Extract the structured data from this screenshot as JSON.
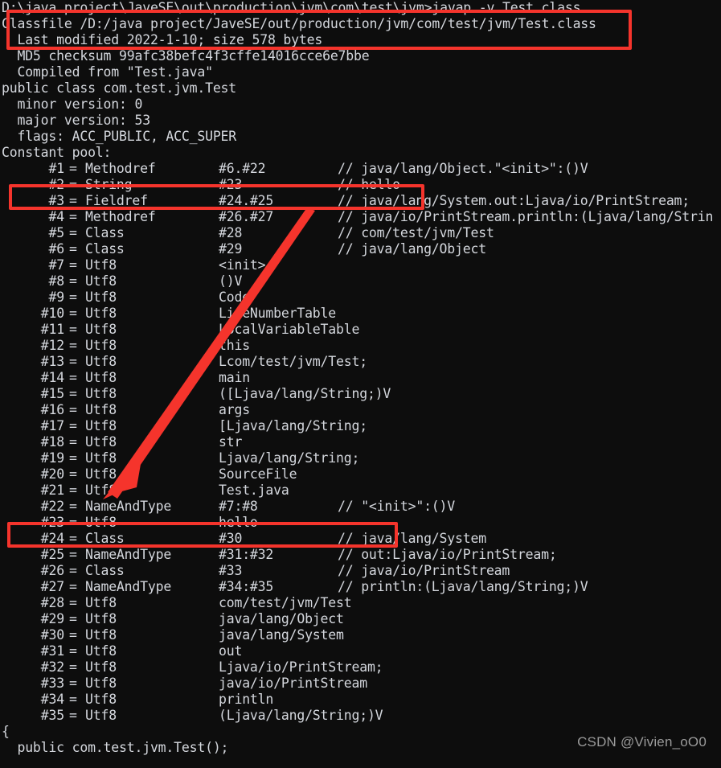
{
  "terminal": {
    "background": "#0d0d0d",
    "text_color": "#d4d7dd",
    "highlight_color": "#f5342c",
    "prompt_line": "D:\\java project\\JaveSE\\out\\production\\jvm\\com\\test\\jvm>javap -v Test.class",
    "header_lines": [
      "Classfile /D:/java project/JaveSE/out/production/jvm/com/test/jvm/Test.class",
      "  Last modified 2022-1-10; size 578 bytes",
      "  MD5 checksum 99afc38befc4f3cffe14016cce6e7bbe",
      "  Compiled from \"Test.java\"",
      "public class com.test.jvm.Test",
      "  minor version: 0",
      "  major version: 53",
      "  flags: ACC_PUBLIC, ACC_SUPER",
      "Constant pool:"
    ],
    "constant_pool": [
      {
        "index": "#1",
        "kind": "Methodref",
        "ref": "#6.#22",
        "comment": "// java/lang/Object.\"<init>\":()V"
      },
      {
        "index": "#2",
        "kind": "String",
        "ref": "#23",
        "comment": "// hello"
      },
      {
        "index": "#3",
        "kind": "Fieldref",
        "ref": "#24.#25",
        "comment": "// java/lang/System.out:Ljava/io/PrintStream;"
      },
      {
        "index": "#4",
        "kind": "Methodref",
        "ref": "#26.#27",
        "comment": "// java/io/PrintStream.println:(Ljava/lang/Strin"
      },
      {
        "index": "#5",
        "kind": "Class",
        "ref": "#28",
        "comment": "// com/test/jvm/Test"
      },
      {
        "index": "#6",
        "kind": "Class",
        "ref": "#29",
        "comment": "// java/lang/Object"
      },
      {
        "index": "#7",
        "kind": "Utf8",
        "ref": "<init>",
        "comment": ""
      },
      {
        "index": "#8",
        "kind": "Utf8",
        "ref": "()V",
        "comment": ""
      },
      {
        "index": "#9",
        "kind": "Utf8",
        "ref": "Code",
        "comment": ""
      },
      {
        "index": "#10",
        "kind": "Utf8",
        "ref": "LineNumberTable",
        "comment": ""
      },
      {
        "index": "#11",
        "kind": "Utf8",
        "ref": "LocalVariableTable",
        "comment": ""
      },
      {
        "index": "#12",
        "kind": "Utf8",
        "ref": "this",
        "comment": ""
      },
      {
        "index": "#13",
        "kind": "Utf8",
        "ref": "Lcom/test/jvm/Test;",
        "comment": ""
      },
      {
        "index": "#14",
        "kind": "Utf8",
        "ref": "main",
        "comment": ""
      },
      {
        "index": "#15",
        "kind": "Utf8",
        "ref": "([Ljava/lang/String;)V",
        "comment": ""
      },
      {
        "index": "#16",
        "kind": "Utf8",
        "ref": "args",
        "comment": ""
      },
      {
        "index": "#17",
        "kind": "Utf8",
        "ref": "[Ljava/lang/String;",
        "comment": ""
      },
      {
        "index": "#18",
        "kind": "Utf8",
        "ref": "str",
        "comment": ""
      },
      {
        "index": "#19",
        "kind": "Utf8",
        "ref": "Ljava/lang/String;",
        "comment": ""
      },
      {
        "index": "#20",
        "kind": "Utf8",
        "ref": "SourceFile",
        "comment": ""
      },
      {
        "index": "#21",
        "kind": "Utf8",
        "ref": "Test.java",
        "comment": ""
      },
      {
        "index": "#22",
        "kind": "NameAndType",
        "ref": "#7:#8",
        "comment": "// \"<init>\":()V"
      },
      {
        "index": "#23",
        "kind": "Utf8",
        "ref": "hello",
        "comment": ""
      },
      {
        "index": "#24",
        "kind": "Class",
        "ref": "#30",
        "comment": "// java/lang/System"
      },
      {
        "index": "#25",
        "kind": "NameAndType",
        "ref": "#31:#32",
        "comment": "// out:Ljava/io/PrintStream;"
      },
      {
        "index": "#26",
        "kind": "Class",
        "ref": "#33",
        "comment": "// java/io/PrintStream"
      },
      {
        "index": "#27",
        "kind": "NameAndType",
        "ref": "#34:#35",
        "comment": "// println:(Ljava/lang/String;)V"
      },
      {
        "index": "#28",
        "kind": "Utf8",
        "ref": "com/test/jvm/Test",
        "comment": ""
      },
      {
        "index": "#29",
        "kind": "Utf8",
        "ref": "java/lang/Object",
        "comment": ""
      },
      {
        "index": "#30",
        "kind": "Utf8",
        "ref": "java/lang/System",
        "comment": ""
      },
      {
        "index": "#31",
        "kind": "Utf8",
        "ref": "out",
        "comment": ""
      },
      {
        "index": "#32",
        "kind": "Utf8",
        "ref": "Ljava/io/PrintStream;",
        "comment": ""
      },
      {
        "index": "#33",
        "kind": "Utf8",
        "ref": "java/io/PrintStream",
        "comment": ""
      },
      {
        "index": "#34",
        "kind": "Utf8",
        "ref": "println",
        "comment": ""
      },
      {
        "index": "#35",
        "kind": "Utf8",
        "ref": "(Ljava/lang/String;)V",
        "comment": ""
      }
    ],
    "footer_lines": [
      "{",
      "  public com.test.jvm.Test();"
    ]
  },
  "annotations": {
    "box_command": "D:\\java project\\JaveSE\\out\\production\\jvm\\com\\test\\jvm>javap -v Test.class",
    "box_string_entry": "#2 = String  #23  // hello",
    "box_utf8_entry": "#23 = Utf8  hello",
    "arrow_label": "arrow from #2 String reference to #23 Utf8 hello"
  },
  "watermark": {
    "text": "CSDN @Vivien_oO0"
  }
}
